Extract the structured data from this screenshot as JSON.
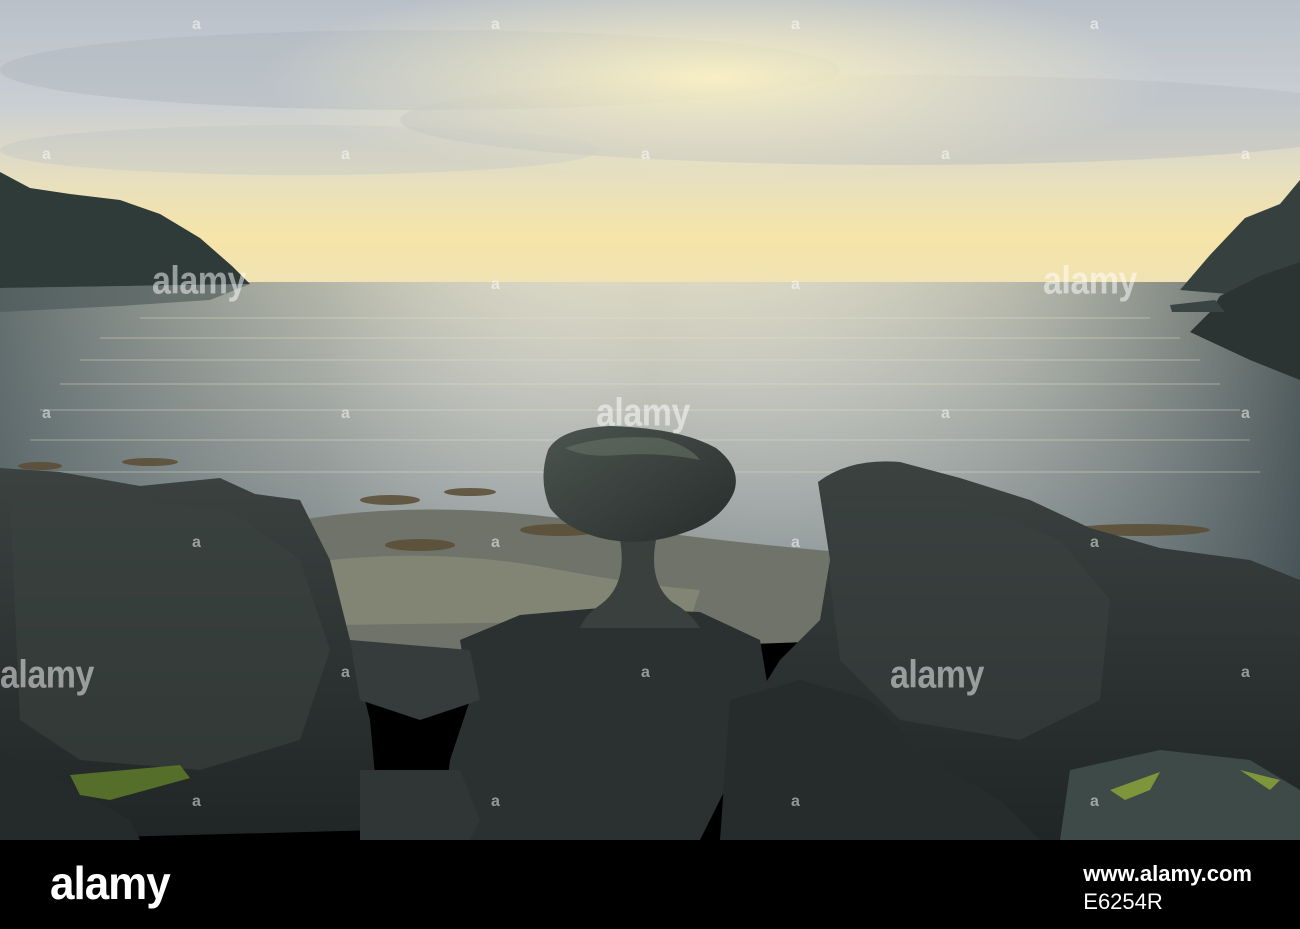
{
  "image": {
    "description_colors": {
      "sky_top": "#c7ccd3",
      "sky_glow": "#f3e2a6",
      "water_light": "#cfd0c4",
      "water_dark": "#5f6d72",
      "rock_dark": "#2a2f30",
      "cliff": "#323c3a"
    }
  },
  "watermark": {
    "brand": "alamy",
    "brand_icon": "alamy-logo"
  },
  "footer": {
    "logo": "alamy",
    "url": "www.alamy.com",
    "image_id": "E6254R"
  }
}
